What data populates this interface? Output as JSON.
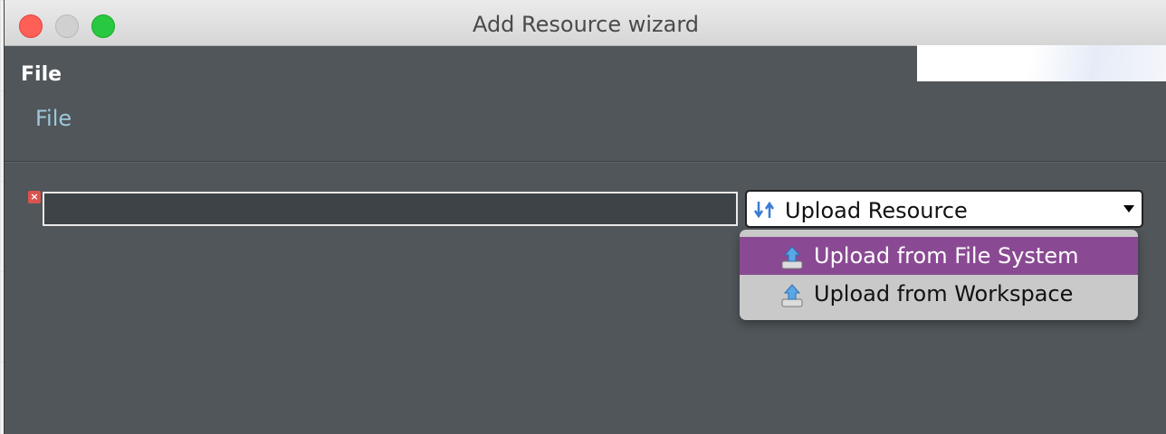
{
  "window": {
    "title": "Add Resource wizard"
  },
  "header": {
    "title": "File",
    "subtitle": "File"
  },
  "form": {
    "path_value": "",
    "combo_label": "Upload Resource",
    "dropdown_items": [
      {
        "label": "Upload from File System",
        "icon": "upload-icon",
        "selected": true
      },
      {
        "label": "Upload from Workspace",
        "icon": "upload-icon",
        "selected": false
      }
    ]
  },
  "colors": {
    "dialog_bg": "#50565a",
    "selection": "#8a4a93",
    "subtitle": "#9ec7da",
    "error": "#d9534f"
  }
}
